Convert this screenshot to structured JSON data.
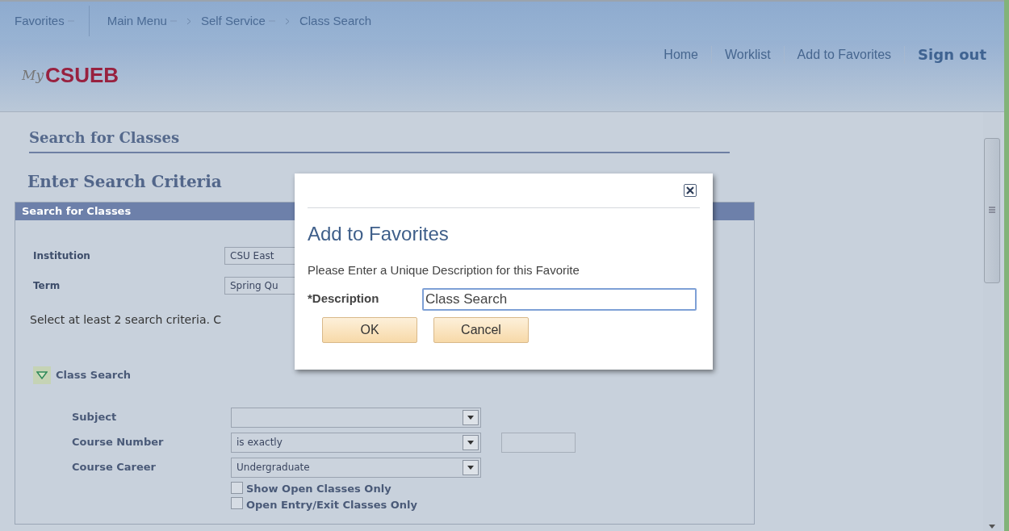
{
  "nav": {
    "favorites": "Favorites",
    "breadcrumbs": [
      {
        "label": "Main Menu",
        "menu": true
      },
      {
        "label": "Self Service",
        "menu": true
      },
      {
        "label": "Class Search",
        "menu": false
      }
    ]
  },
  "header": {
    "logo_prefix": "My",
    "logo": "CSUEB",
    "links": [
      {
        "label": "Home",
        "bold": false
      },
      {
        "label": "Worklist",
        "bold": false
      },
      {
        "label": "Add to Favorites",
        "bold": false
      },
      {
        "label": "Sign out",
        "bold": true
      }
    ]
  },
  "page": {
    "title": "Search for Classes",
    "subtitle": "Enter Search Criteria",
    "panel_title": "Search for Classes",
    "top_fields": [
      {
        "label": "Institution",
        "value": "CSU East"
      },
      {
        "label": "Term",
        "value": "Spring Qu"
      }
    ],
    "instruction": "Select at least 2 search criteria. C",
    "section": {
      "title": "Class Search",
      "expanded": true
    },
    "criteria": [
      {
        "label": "Subject",
        "extra_field": false
      },
      {
        "label": "Course Number",
        "value": "is exactly",
        "extra_field": true
      },
      {
        "label": "Course Career",
        "value": "Undergraduate",
        "extra_field": false
      }
    ],
    "checkboxes": [
      {
        "label": "Show Open Classes Only",
        "checked": false
      },
      {
        "label": "Open Entry/Exit Classes Only",
        "checked": false
      }
    ]
  },
  "dialog": {
    "title": "Add to Favorites",
    "prompt": "Please Enter a Unique Description for this Favorite",
    "field_label": "*Description",
    "field_value": "Class Search",
    "buttons": [
      "OK",
      "Cancel"
    ]
  }
}
